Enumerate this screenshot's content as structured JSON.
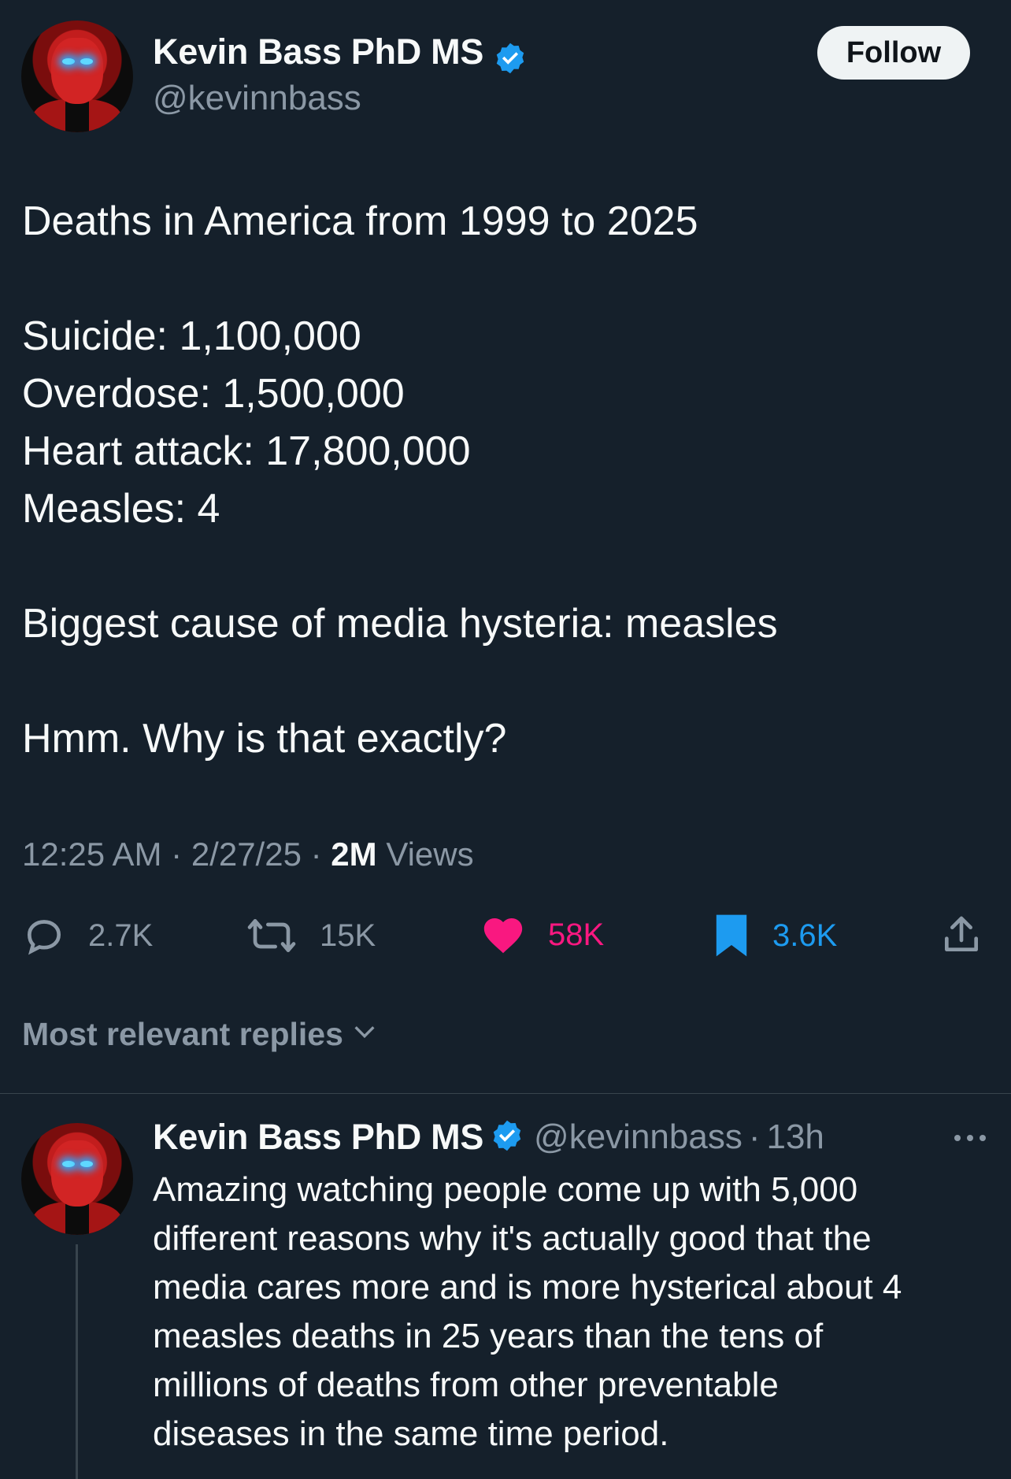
{
  "tweet": {
    "author": {
      "name": "Kevin Bass PhD MS",
      "handle": "@kevinnbass"
    },
    "follow_label": "Follow",
    "lines": [
      "Deaths in America from 1999 to 2025",
      "",
      "Suicide: 1,100,000",
      "Overdose: 1,500,000",
      "Heart attack: 17,800,000",
      "Measles: 4",
      "",
      "Biggest cause of media hysteria: measles",
      "",
      "Hmm. Why is that exactly?"
    ],
    "time": "12:25 AM",
    "date": "2/27/25",
    "views_count": "2M",
    "views_label": "Views",
    "sep": "·"
  },
  "actions": {
    "replies": "2.7K",
    "reposts": "15K",
    "likes": "58K",
    "bookmarks": "3.6K"
  },
  "colors": {
    "like": "#f91880",
    "bookmark": "#1d9bf0",
    "background": "#15202b",
    "muted": "#8b98a5"
  },
  "replies_filter": {
    "label": "Most relevant replies"
  },
  "reply": {
    "author": {
      "name": "Kevin Bass PhD MS",
      "handle": "@kevinnbass",
      "time": "13h"
    },
    "lines": [
      "Amazing watching people come up with 5,000",
      "different reasons why it's actually good that the",
      "media cares more and is more hysterical about 4",
      "measles deaths in 25 years than the tens of",
      "millions of deaths from other preventable",
      "diseases in the same time period."
    ]
  }
}
